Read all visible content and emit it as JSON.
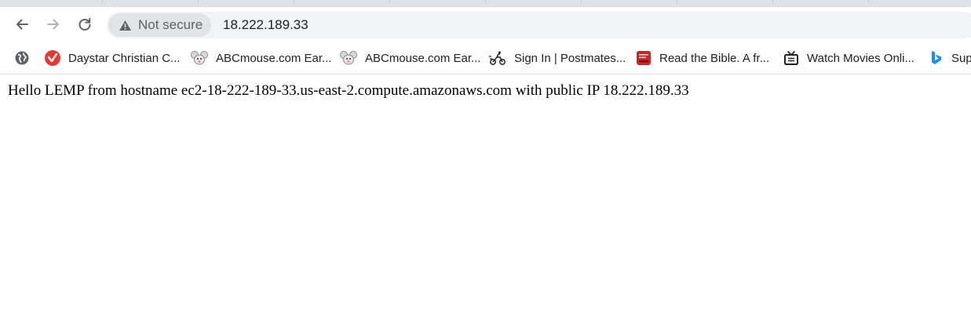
{
  "browser": {
    "address_bar": {
      "security_label": "Not secure",
      "url": "18.222.189.33"
    },
    "icons": {
      "back": "back-arrow-icon",
      "forward": "forward-arrow-icon",
      "reload": "reload-icon",
      "warning": "warning-triangle-icon"
    },
    "colors": {
      "toolbar_bg": "#ffffff",
      "omnibox_bg": "#f1f3f4",
      "tabstrip_bg": "#dee1e6"
    }
  },
  "bookmarks": [
    {
      "label": "",
      "icon": "globe-icon"
    },
    {
      "label": "Daystar Christian C...",
      "icon": "daystar-icon"
    },
    {
      "label": "ABCmouse.com Ear...",
      "icon": "mouse-icon"
    },
    {
      "label": "ABCmouse.com Ear...",
      "icon": "mouse-icon"
    },
    {
      "label": "Sign In | Postmates...",
      "icon": "courier-icon"
    },
    {
      "label": "Read the Bible. A fr...",
      "icon": "bible-icon"
    },
    {
      "label": "Watch Movies Onli...",
      "icon": "tv-icon"
    },
    {
      "label": "Sup",
      "icon": "bing-icon"
    }
  ],
  "page": {
    "text": "Hello LEMP from hostname ec2-18-222-189-33.us-east-2.compute.amazonaws.com with public IP 18.222.189.33"
  }
}
